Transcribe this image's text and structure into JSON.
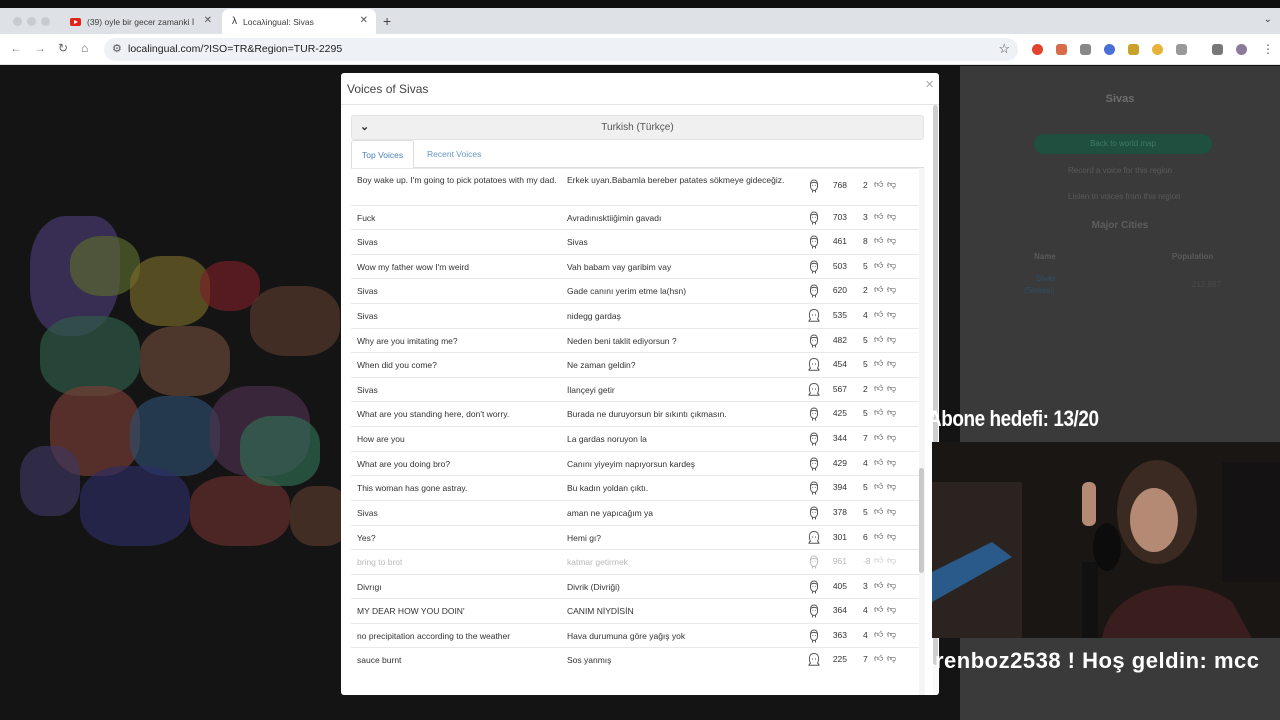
{
  "browser": {
    "tabs": [
      {
        "label": "(39) oyle bir gecer zamanki İ",
        "icon": "youtube-icon"
      },
      {
        "label": "Locaλingual: Sivas",
        "icon": "lambda-icon"
      }
    ],
    "new_tab_label": "+",
    "url": "localingual.com/?ISO=TR&Region=TUR-2295"
  },
  "sidepanel": {
    "title": "Sivas",
    "back_button": "Back to world map",
    "record_link": "Record a voice for this region",
    "listen_link": "Listen to voices from this region",
    "major_cities": "Major Cities",
    "col_name": "Name",
    "col_population": "Population",
    "city_name": "Sivas",
    "city_sub": "(Sivassi)",
    "city_population": "212,887"
  },
  "modal": {
    "title": "Voices of Sivas",
    "close": "×",
    "language": "Turkish (Türkçe)",
    "tab_top": "Top Voices",
    "tab_recent": "Recent Voices",
    "rows": [
      {
        "en": "Boy wake up. I'm going to pick potatoes with my dad.",
        "tr": "Erkek uyan.Babamla bereber patates sökmeye gideceğiz.",
        "count": "768",
        "score": "2",
        "gender": "male",
        "dim": false
      },
      {
        "en": "Fuck",
        "tr": "Avradınısktiiğimin gavadı",
        "count": "703",
        "score": "3",
        "gender": "male",
        "dim": false
      },
      {
        "en": "Sivas",
        "tr": "Sivas",
        "count": "461",
        "score": "8",
        "gender": "male",
        "dim": false
      },
      {
        "en": "Wow my father wow I'm weird",
        "tr": "Vah babam vay garibim vay",
        "count": "503",
        "score": "5",
        "gender": "male",
        "dim": false
      },
      {
        "en": "Sivas",
        "tr": "Gade canını yerim etme la(hsn)",
        "count": "620",
        "score": "2",
        "gender": "male",
        "dim": false
      },
      {
        "en": "Sivas",
        "tr": "nidegg gardaş",
        "count": "535",
        "score": "4",
        "gender": "female",
        "dim": false
      },
      {
        "en": "Why are you imitating me?",
        "tr": "Neden beni taklit ediyorsun ?",
        "count": "482",
        "score": "5",
        "gender": "male",
        "dim": false
      },
      {
        "en": "When did you come?",
        "tr": "Ne zaman geldin?",
        "count": "454",
        "score": "5",
        "gender": "female",
        "dim": false
      },
      {
        "en": "Sivas",
        "tr": "İlançeyi getir",
        "count": "567",
        "score": "2",
        "gender": "female",
        "dim": false
      },
      {
        "en": "What are you standing here, don't worry.",
        "tr": "Burada ne duruyorsun bir sıkıntı çıkmasın.",
        "count": "425",
        "score": "5",
        "gender": "male",
        "dim": false
      },
      {
        "en": "How are you",
        "tr": "La gardas noruyon la",
        "count": "344",
        "score": "7",
        "gender": "male",
        "dim": false
      },
      {
        "en": "What are you doing bro?",
        "tr": "Canını yiyeyim napıyorsun kardeş",
        "count": "429",
        "score": "4",
        "gender": "male",
        "dim": false
      },
      {
        "en": "This woman has gone astray.",
        "tr": "Bu kadın yoldan çıktı.",
        "count": "394",
        "score": "5",
        "gender": "male",
        "dim": false
      },
      {
        "en": "Sivas",
        "tr": "aman ne yapıcağım ya",
        "count": "378",
        "score": "5",
        "gender": "male",
        "dim": false
      },
      {
        "en": "Yes?",
        "tr": "Hemi gı?",
        "count": "301",
        "score": "6",
        "gender": "female",
        "dim": false
      },
      {
        "en": "bring to brot",
        "tr": "katmar getirmek",
        "count": "961",
        "score": "-8",
        "gender": "male",
        "dim": true
      },
      {
        "en": "Divrıgı",
        "tr": "Divrik (Divriği)",
        "count": "405",
        "score": "3",
        "gender": "male",
        "dim": false
      },
      {
        "en": "MY DEAR HOW YOU DOIN'",
        "tr": "CANIM NİYDİSİN",
        "count": "364",
        "score": "4",
        "gender": "male",
        "dim": false
      },
      {
        "en": "no precipitation according to the weather",
        "tr": "Hava durumuna göre yağış yok",
        "count": "363",
        "score": "4",
        "gender": "male",
        "dim": false
      },
      {
        "en": "sauce burnt",
        "tr": "Sos yanmış",
        "count": "225",
        "score": "7",
        "gender": "female",
        "dim": false
      }
    ]
  },
  "overlay": {
    "goal": "Abone hedefi: 13/20",
    "ticker": "renboz2538 !    Hoş geldin: mcc"
  },
  "colors": {
    "accent_link": "#4a82b6",
    "map_bg": "#141414",
    "dim_text": "#b9b9b9"
  }
}
